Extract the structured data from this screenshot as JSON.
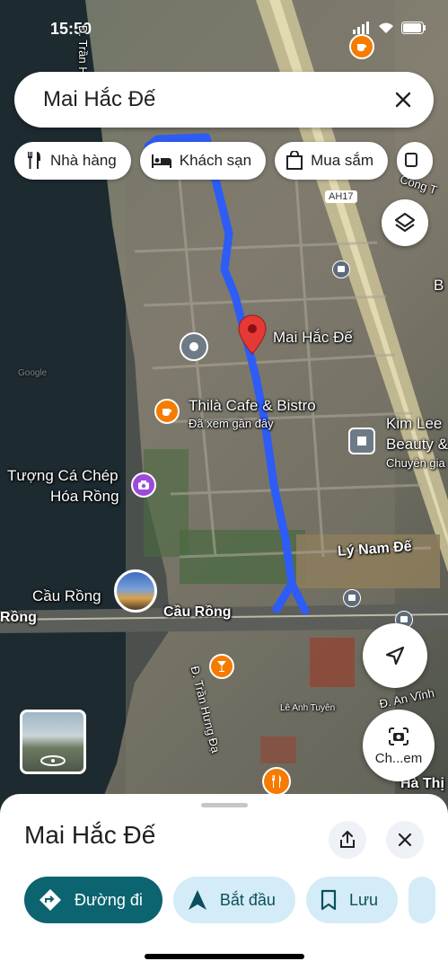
{
  "status": {
    "time": "15:50"
  },
  "search": {
    "query": "Mai Hắc Đế"
  },
  "chips": [
    {
      "label": "Nhà hàng",
      "icon": "restaurant-icon"
    },
    {
      "label": "Khách sạn",
      "icon": "hotel-icon"
    },
    {
      "label": "Mua sắm",
      "icon": "shopping-icon"
    }
  ],
  "map": {
    "street_tran_hung_dao_top": "Đ. Trần H",
    "road_cong": "Công T",
    "road_ah17": "AH17",
    "letter_b": "B",
    "destination_label": "Mai Hắc Đế",
    "cafe_name": "Thilà Cafe & Bistro",
    "cafe_sub": "Đã xem gần đây",
    "beauty_name_1": "Kim Lee",
    "beauty_name_2": "Beauty &",
    "beauty_sub": "Chuyên gia",
    "statue_line1": "Tượng Cá Chép",
    "statue_line2": "Hóa Rồng",
    "street_ly_nam_de": "Lý Nam Đế",
    "bridge_label": "Cầu Rồng",
    "bridge_road": "Cầu Rồng",
    "bridge_road_left": "Rồng",
    "street_tran_hung_dao": "Đ. Trần Hưng Đạ",
    "street_an_vinh": "Đ. An Vĩnh",
    "street_ha_thi": "Hà Thị",
    "le_anh_tuyen": "Lê Anh Tuyên",
    "google_watermark": "Google",
    "camera_label": "Ch...em"
  },
  "sheet": {
    "title": "Mai Hắc Đế",
    "actions": [
      {
        "label": "Đường đi",
        "icon": "directions-icon"
      },
      {
        "label": "Bắt đầu",
        "icon": "navigation-arrow-icon"
      },
      {
        "label": "Lưu",
        "icon": "bookmark-icon"
      }
    ]
  },
  "colors": {
    "route": "#2d5cf6",
    "pin": "#e53935",
    "primary": "#0b6470",
    "cafe": "#f57c00",
    "attraction": "#9c4bd9"
  }
}
